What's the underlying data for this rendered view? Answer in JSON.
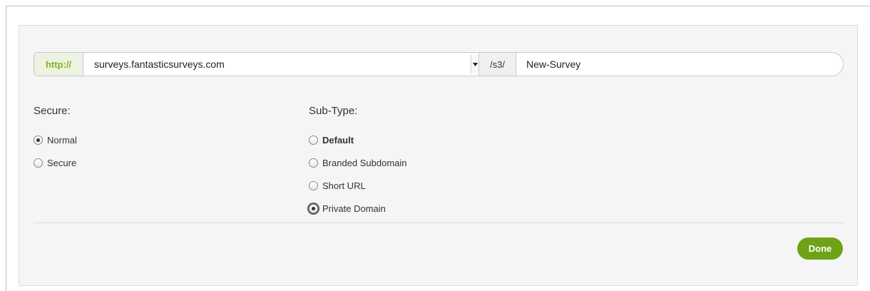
{
  "url_builder": {
    "protocol": "http://",
    "domain": "surveys.fantasticsurveys.com",
    "path_prefix": "/s3/",
    "slug_value": "New-Survey"
  },
  "secure_group": {
    "label": "Secure:",
    "options": [
      {
        "label": "Normal",
        "checked": true
      },
      {
        "label": "Secure",
        "checked": false
      }
    ]
  },
  "subtype_group": {
    "label": "Sub-Type:",
    "options": [
      {
        "label": "Default",
        "checked": false
      },
      {
        "label": "Branded Subdomain",
        "checked": false
      },
      {
        "label": "Short URL",
        "checked": false
      },
      {
        "label": "Private Domain",
        "checked": true
      }
    ]
  },
  "actions": {
    "done_label": "Done"
  },
  "colors": {
    "accent_green": "#6ea318",
    "protocol_green": "#7cb518",
    "panel_bg": "#f5f5f5"
  }
}
